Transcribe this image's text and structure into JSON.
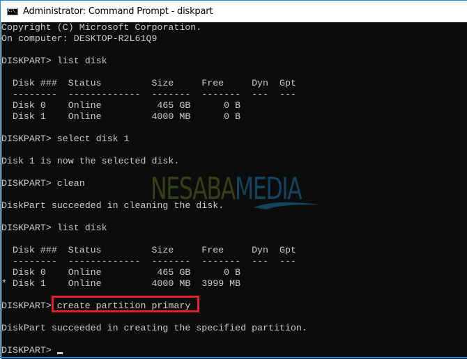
{
  "window": {
    "title": "Administrator: Command Prompt - diskpart",
    "icon": "command-prompt-icon",
    "icon_text": "C:\\_"
  },
  "console": {
    "lines": [
      "Copyright (C) Microsoft Corporation.",
      "On computer: DESKTOP-R2L61Q9",
      "",
      "DISKPART> list disk",
      "",
      "  Disk ###  Status         Size     Free     Dyn  Gpt",
      "  --------  -------------  -------  -------  ---  ---",
      "  Disk 0    Online          465 GB      0 B",
      "  Disk 1    Online         4000 MB      0 B",
      "",
      "DISKPART> select disk 1",
      "",
      "Disk 1 is now the selected disk.",
      "",
      "DISKPART> clean",
      "",
      "DiskPart succeeded in cleaning the disk.",
      "",
      "DISKPART> list disk",
      "",
      "  Disk ###  Status         Size     Free     Dyn  Gpt",
      "  --------  -------------  -------  -------  ---  ---",
      "  Disk 0    Online          465 GB      0 B",
      "* Disk 1    Online         4000 MB  3999 MB",
      "",
      "DISKPART> create partition primary",
      "",
      "DiskPart succeeded in creating the specified partition.",
      "",
      "DISKPART> "
    ],
    "highlighted_command": "create partition primary",
    "highlight_color": "#e0202a",
    "background_color": "#0c0c0c",
    "text_color": "#cccccc"
  },
  "watermark": {
    "part1": "NESABA",
    "part2": "MEDIA"
  }
}
